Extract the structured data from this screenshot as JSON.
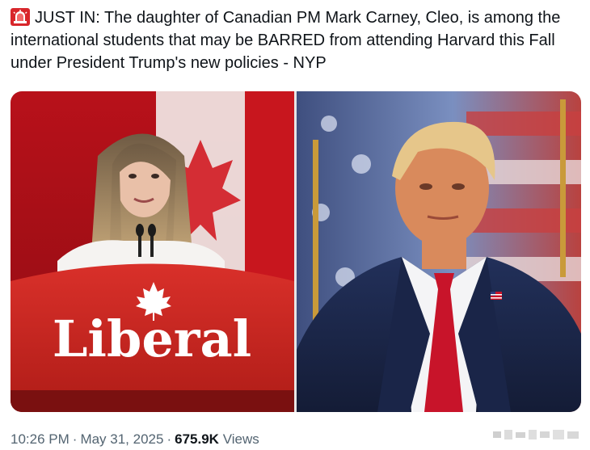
{
  "tweet": {
    "icon": "rotating-light-icon",
    "text": "JUST IN: The daughter of Canadian PM Mark Carney, Cleo, is among the international students that may be BARRED from attending Harvard this Fall under President Trump's new policies - NYP"
  },
  "media": {
    "left_photo": {
      "podium_text": "Liberal",
      "icon": "maple-leaf-icon"
    },
    "right_photo": {
      "icon": "us-flag-pin-icon"
    }
  },
  "meta": {
    "time": "10:26 PM",
    "date": "May 31, 2025",
    "separator": "·",
    "views_count": "675.9K",
    "views_label": "Views"
  },
  "colors": {
    "text": "#0f1419",
    "muted": "#536471",
    "liberal_red": "#d52b1e",
    "suit_navy": "#1c2a4a"
  }
}
